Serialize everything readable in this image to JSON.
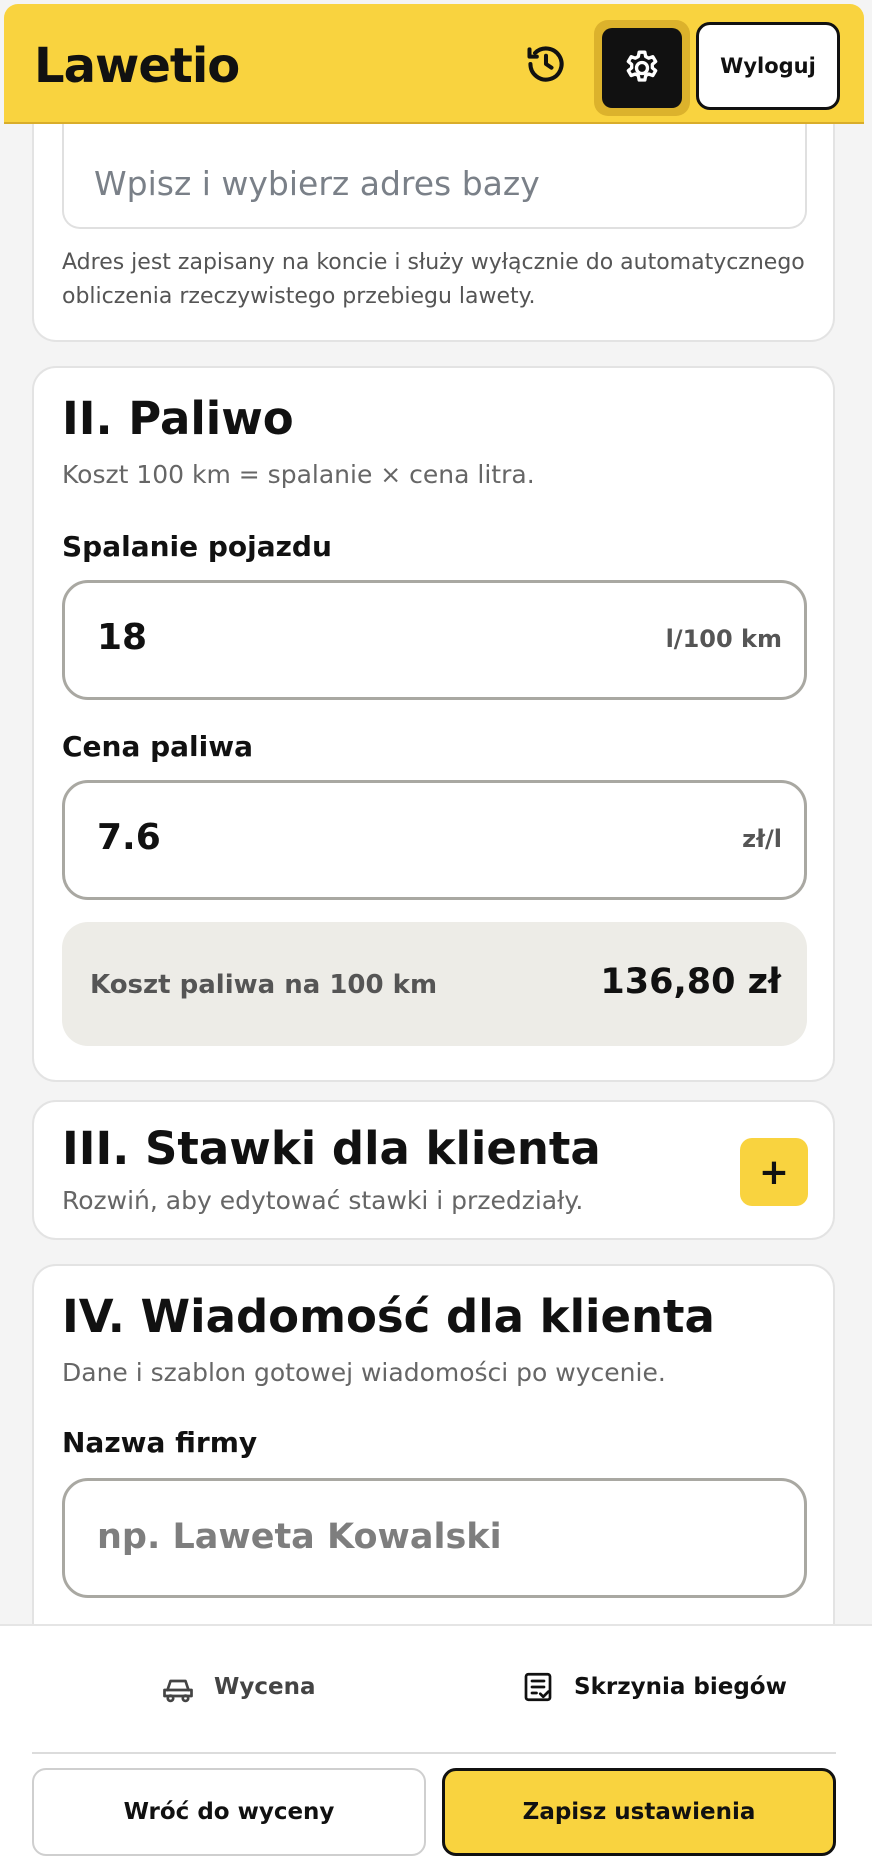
{
  "app": {
    "title": "Lawetio"
  },
  "header": {
    "logout_label": "Wyloguj",
    "history_icon": "history-icon",
    "settings_icon": "gear-icon"
  },
  "section_base": {
    "address_placeholder": "Wpisz i wybierz adres bazy",
    "hint": "Adres jest zapisany na koncie i służy wyłącznie do automatycznego obliczenia rzeczywistego przebiegu lawety."
  },
  "section_fuel": {
    "title": "II. Paliwo",
    "subtitle": "Koszt 100 km = spalanie × cena litra.",
    "consumption_label": "Spalanie pojazdu",
    "consumption_value": "18",
    "consumption_unit": "l/100 km",
    "price_label": "Cena paliwa",
    "price_value": "7.6",
    "price_unit": "zł/l",
    "cost_label": "Koszt paliwa na 100 km",
    "cost_value": "136,80 zł"
  },
  "section_rates": {
    "title": "III. Stawki dla klienta",
    "subtitle": "Rozwiń, aby edytować stawki i przedziały.",
    "expand_label": "+"
  },
  "section_message": {
    "title": "IV. Wiadomość dla klienta",
    "subtitle": "Dane i szablon gotowej wiadomości po wycenie.",
    "company_label": "Nazwa firmy",
    "company_placeholder": "np. Laweta Kowalski"
  },
  "bottom_nav": {
    "tab_quote": "Wycena",
    "tab_gearbox": "Skrzynia biegów",
    "back_button": "Wróć do wyceny",
    "save_button": "Zapisz ustawienia"
  },
  "colors": {
    "accent": "#f9d33f",
    "dark": "#111111"
  }
}
